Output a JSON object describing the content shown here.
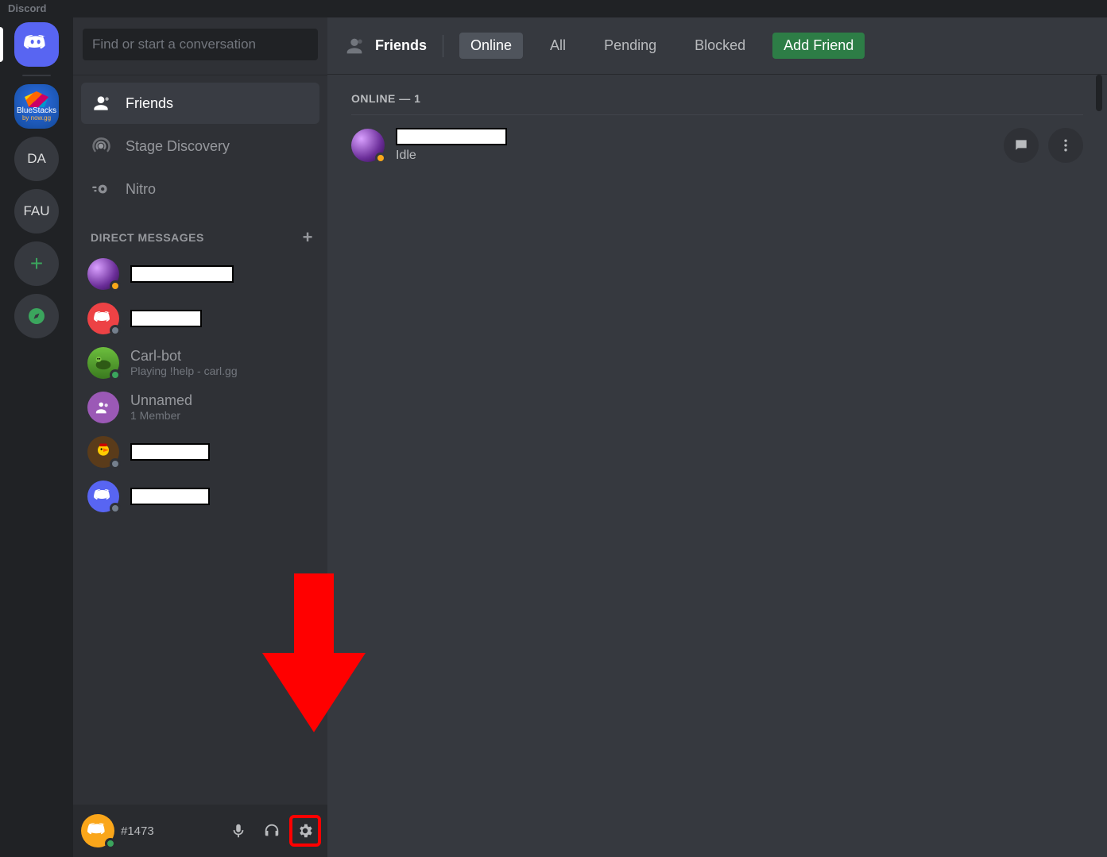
{
  "window": {
    "title": "Discord"
  },
  "servers": {
    "bluestacks_line1": "BlueStacks",
    "bluestacks_line2": "by now.gg",
    "da": "DA",
    "fau": "FAU"
  },
  "search": {
    "placeholder": "Find or start a conversation"
  },
  "nav": {
    "friends": "Friends",
    "stage": "Stage Discovery",
    "nitro": "Nitro"
  },
  "dm": {
    "header": "DIRECT MESSAGES",
    "carl_name": "Carl-bot",
    "carl_sub": "Playing !help - carl.gg",
    "unnamed_name": "Unnamed",
    "unnamed_sub": "1 Member"
  },
  "userpanel": {
    "tag": "#1473"
  },
  "topbar": {
    "title": "Friends",
    "tabs": {
      "online": "Online",
      "all": "All",
      "pending": "Pending",
      "blocked": "Blocked",
      "add": "Add Friend"
    }
  },
  "friends": {
    "section": "ONLINE — 1",
    "row1_status": "Idle"
  }
}
